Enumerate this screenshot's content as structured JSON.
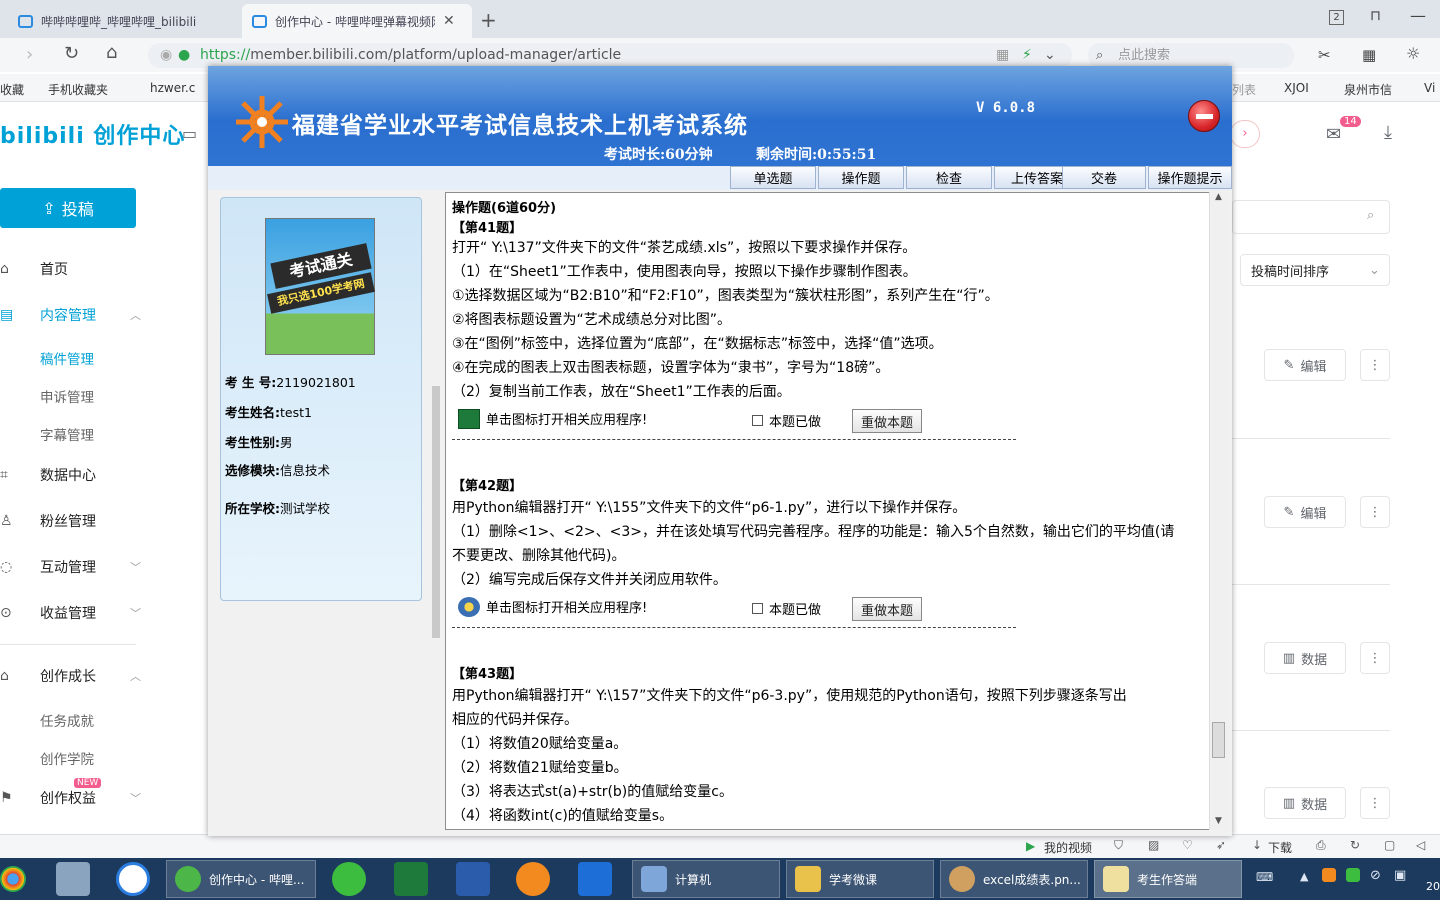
{
  "browser": {
    "tabs": [
      {
        "title": "哔哔哔哩哔_哔哩哔哩_bilibili"
      },
      {
        "title": "创作中心 - 哔哩哔哩弹幕视频网"
      }
    ],
    "tab_count": "2",
    "url_scheme": "https://",
    "url_rest": "member.bilibili.com/platform/upload-manager/article",
    "search_placeholder": "点此搜索",
    "bookmarks": [
      "收藏",
      "手机收藏夹",
      "hzwer.c"
    ],
    "bookmarks_right": [
      "列表",
      "XJOI",
      "泉州市信",
      "Vi"
    ]
  },
  "bili": {
    "logo": "bilibili 创作中心",
    "upload_label": "投稿",
    "notification_count": "14",
    "nav": [
      {
        "label": "首页",
        "icon": "home-icon"
      },
      {
        "label": "内容管理",
        "icon": "content-icon",
        "expand": "︿"
      },
      {
        "label": "数据中心",
        "icon": "chart-icon"
      },
      {
        "label": "粉丝管理",
        "icon": "user-icon"
      },
      {
        "label": "互动管理",
        "icon": "chat-icon",
        "expand": "﹀"
      },
      {
        "label": "收益管理",
        "icon": "coin-icon",
        "expand": "﹀"
      },
      {
        "label": "创作成长",
        "icon": "cap-icon",
        "expand": "︿"
      },
      {
        "label": "创作权益",
        "icon": "flag-icon",
        "expand": "﹀"
      }
    ],
    "sub_content": [
      "稿件管理",
      "申诉管理",
      "字幕管理"
    ],
    "sub_growth": [
      "任务成就",
      "创作学院"
    ],
    "new_badge": "NEW",
    "sort_label": "投稿时间排序",
    "edit_label": "编辑",
    "data_label": "数据",
    "statusbar": [
      "我的视频",
      "下载"
    ]
  },
  "exam": {
    "title": "福建省学业水平考试信息技术上机考试系统",
    "version": "V 6.0.8",
    "duration": "考试时长:60分钟",
    "remaining": "剩余时间:0:55:51",
    "menu": [
      "单选题",
      "操作题",
      "检查",
      "上传答案",
      "交卷",
      "操作题提示"
    ],
    "candidate": {
      "id_label": "考 生 号:",
      "id": "2119021801",
      "name_label": "考生姓名:",
      "name": "test1",
      "gender_label": "考生性别:",
      "gender": "男",
      "module_label": "选修模块:",
      "module": "信息技术",
      "school_label": "所在学校:",
      "school": "测试学校",
      "cover_line1": "考试通关",
      "cover_line2": "我只选100学考网"
    },
    "section_header": "操作题(6道60分)",
    "q41": {
      "no": "【第41题】",
      "lines": [
        "打开“ Y:\\137”文件夹下的文件“茶艺成绩.xls”，按照以下要求操作并保存。",
        "（1）在“Sheet1”工作表中，使用图表向导，按照以下操作步骤制作图表。",
        "①选择数据区域为“B2:B10”和“F2:F10”，图表类型为“簇状柱形图”，系列产生在“行”。",
        "②将图表标题设置为“艺术成绩总分对比图”。",
        "③在“图例”标签中，选择位置为“底部”，在“数据标志”标签中，选择“值”选项。",
        "④在完成的图表上双击图表标题，设置字体为“隶书”，字号为“18磅”。",
        "（2）复制当前工作表，放在“Sheet1”工作表的后面。"
      ]
    },
    "q42": {
      "no": "【第42题】",
      "lines": [
        "用Python编辑器打开“ Y:\\155”文件夹下的文件“p6-1.py”，进行以下操作并保存。",
        "（1）删除<1>、<2>、<3>，并在该处填写代码完善程序。程序的功能是：输入5个自然数，输出它们的平均值(请",
        "不要更改、删除其他代码)。",
        "（2）编写完成后保存文件并关闭应用软件。"
      ]
    },
    "q43": {
      "no": "【第43题】",
      "lines": [
        "用Python编辑器打开“ Y:\\157”文件夹下的文件“p6-3.py”，使用规范的Python语句，按照下列步骤逐条写出",
        "相应的代码并保存。",
        "（1）将数值20赋给变量a。",
        "（2）将数值21赋给变量b。",
        "（3）将表达式st(a)+str(b)的值赋给变量c。",
        "（4）将函数int(c)的值赋给变量s。"
      ]
    },
    "open_app": "单击图标打开相关应用程序!",
    "done_label": "本题已做",
    "redo_label": "重做本题"
  },
  "taskbar": {
    "items": [
      "创作中心 - 哔哩...",
      "计算机",
      "学考微课",
      "excel成绩表.pn...",
      "考生作答端"
    ],
    "clock": "20"
  },
  "colors": {
    "accent": "#00a1d6",
    "exam_blue": "#2a6fcf",
    "taskbar": "#1c3a5e"
  }
}
